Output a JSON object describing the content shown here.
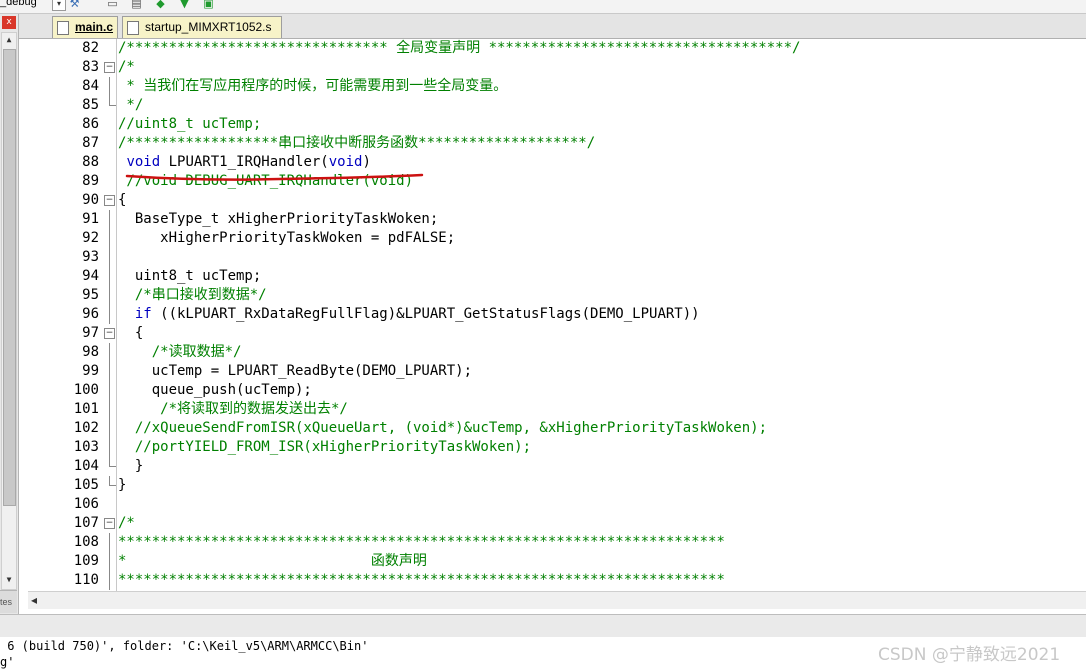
{
  "toolbar": {
    "target_select": "_debug",
    "icons": [
      "dropdown-arrow-icon",
      "build-target-icon",
      "new-file-icon",
      "copy-icon",
      "download-icon",
      "options-icon",
      "manage-icon"
    ]
  },
  "left_panel": {
    "close_glyph": "x",
    "tab_label": "tes"
  },
  "tabs": [
    {
      "label": "main.c",
      "active": true
    },
    {
      "label": "startup_MIMXRT1052.s",
      "active": false
    }
  ],
  "editor": {
    "lines": [
      {
        "n": "82",
        "fold": "",
        "segments": [
          {
            "t": "/******************************* 全局变量声明 ************************************/",
            "c": "com"
          }
        ]
      },
      {
        "n": "83",
        "fold": "box",
        "segments": [
          {
            "t": "/*",
            "c": "com"
          }
        ]
      },
      {
        "n": "84",
        "fold": "line",
        "segments": [
          {
            "t": " * 当我们在写应用程序的时候，可能需要用到一些全局变量。",
            "c": "com"
          }
        ]
      },
      {
        "n": "85",
        "fold": "end",
        "segments": [
          {
            "t": " */",
            "c": "com"
          }
        ]
      },
      {
        "n": "86",
        "fold": "",
        "segments": [
          {
            "t": "//uint8_t ucTemp;",
            "c": "com"
          }
        ]
      },
      {
        "n": "87",
        "fold": "",
        "segments": [
          {
            "t": "/******************串口接收中断服务函数********************/",
            "c": "com"
          }
        ]
      },
      {
        "n": "88",
        "fold": "",
        "segments": [
          {
            "t": " ",
            "c": "txt"
          },
          {
            "t": "void",
            "c": "kw"
          },
          {
            "t": " LPUART1_IRQHandler(",
            "c": "txt"
          },
          {
            "t": "void",
            "c": "kw"
          },
          {
            "t": ")",
            "c": "txt"
          }
        ]
      },
      {
        "n": "89",
        "fold": "",
        "segments": [
          {
            "t": " //void DEBUG_UART_IRQHandler(void)",
            "c": "com"
          }
        ]
      },
      {
        "n": "90",
        "fold": "box",
        "segments": [
          {
            "t": "{",
            "c": "txt"
          }
        ]
      },
      {
        "n": "91",
        "fold": "line",
        "segments": [
          {
            "t": "  BaseType_t xHigherPriorityTaskWoken;",
            "c": "txt"
          }
        ]
      },
      {
        "n": "92",
        "fold": "line",
        "segments": [
          {
            "t": "     xHigherPriorityTaskWoken = pdFALSE;",
            "c": "txt"
          }
        ]
      },
      {
        "n": "93",
        "fold": "line",
        "segments": [
          {
            "t": "",
            "c": "txt"
          }
        ]
      },
      {
        "n": "94",
        "fold": "line",
        "segments": [
          {
            "t": "  uint8_t ucTemp;",
            "c": "txt"
          }
        ]
      },
      {
        "n": "95",
        "fold": "line",
        "segments": [
          {
            "t": "  /*串口接收到数据*/",
            "c": "com"
          }
        ]
      },
      {
        "n": "96",
        "fold": "line",
        "segments": [
          {
            "t": "  ",
            "c": "txt"
          },
          {
            "t": "if",
            "c": "kw"
          },
          {
            "t": " ((kLPUART_RxDataRegFullFlag)&LPUART_GetStatusFlags(DEMO_LPUART))",
            "c": "txt"
          }
        ]
      },
      {
        "n": "97",
        "fold": "box",
        "segments": [
          {
            "t": "  {",
            "c": "txt"
          }
        ]
      },
      {
        "n": "98",
        "fold": "line",
        "segments": [
          {
            "t": "    /*读取数据*/",
            "c": "com"
          }
        ]
      },
      {
        "n": "99",
        "fold": "line",
        "segments": [
          {
            "t": "    ucTemp = LPUART_ReadByte(DEMO_LPUART);",
            "c": "txt"
          }
        ]
      },
      {
        "n": "100",
        "fold": "line",
        "segments": [
          {
            "t": "    queue_push(ucTemp);",
            "c": "txt"
          }
        ]
      },
      {
        "n": "101",
        "fold": "line",
        "segments": [
          {
            "t": "     /*将读取到的数据发送出去*/",
            "c": "com"
          }
        ]
      },
      {
        "n": "102",
        "fold": "line",
        "segments": [
          {
            "t": "  //xQueueSendFromISR(xQueueUart, (void*)&ucTemp, &xHigherPriorityTaskWoken);",
            "c": "com"
          }
        ]
      },
      {
        "n": "103",
        "fold": "line",
        "segments": [
          {
            "t": "  //portYIELD_FROM_ISR(xHigherPriorityTaskWoken);",
            "c": "com"
          }
        ]
      },
      {
        "n": "104",
        "fold": "end",
        "segments": [
          {
            "t": "  }",
            "c": "txt"
          }
        ]
      },
      {
        "n": "105",
        "fold": "end",
        "segments": [
          {
            "t": "}",
            "c": "txt"
          }
        ]
      },
      {
        "n": "106",
        "fold": "",
        "segments": [
          {
            "t": "",
            "c": "txt"
          }
        ]
      },
      {
        "n": "107",
        "fold": "box",
        "segments": [
          {
            "t": "/*",
            "c": "com"
          }
        ]
      },
      {
        "n": "108",
        "fold": "line",
        "segments": [
          {
            "t": "************************************************************************",
            "c": "com"
          }
        ]
      },
      {
        "n": "109",
        "fold": "line",
        "segments": [
          {
            "t": "*                             函数声明",
            "c": "com"
          }
        ]
      },
      {
        "n": "110",
        "fold": "line",
        "segments": [
          {
            "t": "************************************************************************",
            "c": "com"
          }
        ]
      }
    ]
  },
  "build_output": {
    "line1": " 6 (build 750)', folder: 'C:\\Keil_v5\\ARM\\ARMCC\\Bin'",
    "line2": "g'"
  },
  "watermark": "CSDN @宁静致远2021",
  "colors": {
    "comment": "#008000",
    "keyword": "#0000c0",
    "text": "#000000",
    "annotation": "#cc1111",
    "tab_bg": "#f7f3c8"
  }
}
